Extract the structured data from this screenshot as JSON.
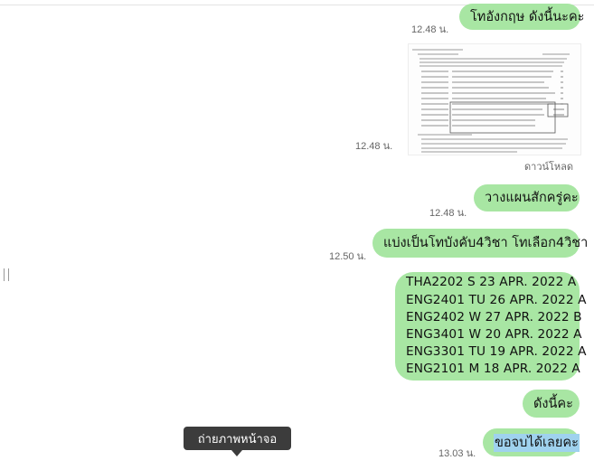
{
  "messages": [
    {
      "text": "โทอังกฤษ ดังนี้นะคะ",
      "time": "12.48 น."
    },
    {
      "time": "12.48 น.",
      "download_label": "ดาวน์โหลด"
    },
    {
      "text": "วางแผนสักครู่คะ",
      "time": "12.48 น."
    },
    {
      "text": "แบ่งเป็นโทบังคับ4วิชา โทเลือก4วิชา",
      "time": "12.50 น."
    },
    {
      "lines": [
        "THA2202 S 23 APR. 2022 A",
        "ENG2401 TU 26 APR. 2022 A",
        "ENG2402 W 27 APR. 2022 B",
        "ENG3401 W 20 APR. 2022 A",
        "ENG3301 TU 19 APR. 2022 A",
        "ENG2101 M 18 APR. 2022 A"
      ]
    },
    {
      "text": "ดังนี้คะ"
    },
    {
      "text": "ขอจบได้เลยคะ",
      "time": "13.03 น."
    }
  ],
  "tooltip": "ถ่ายภาพหน้าจอ",
  "colors": {
    "bubble": "#a8e6a3",
    "highlight": "#9fd2ee",
    "tooltip_bg": "#3c3c3c"
  },
  "icons": {
    "image": "document-image-icon",
    "handle": "resize-handle-icon"
  }
}
